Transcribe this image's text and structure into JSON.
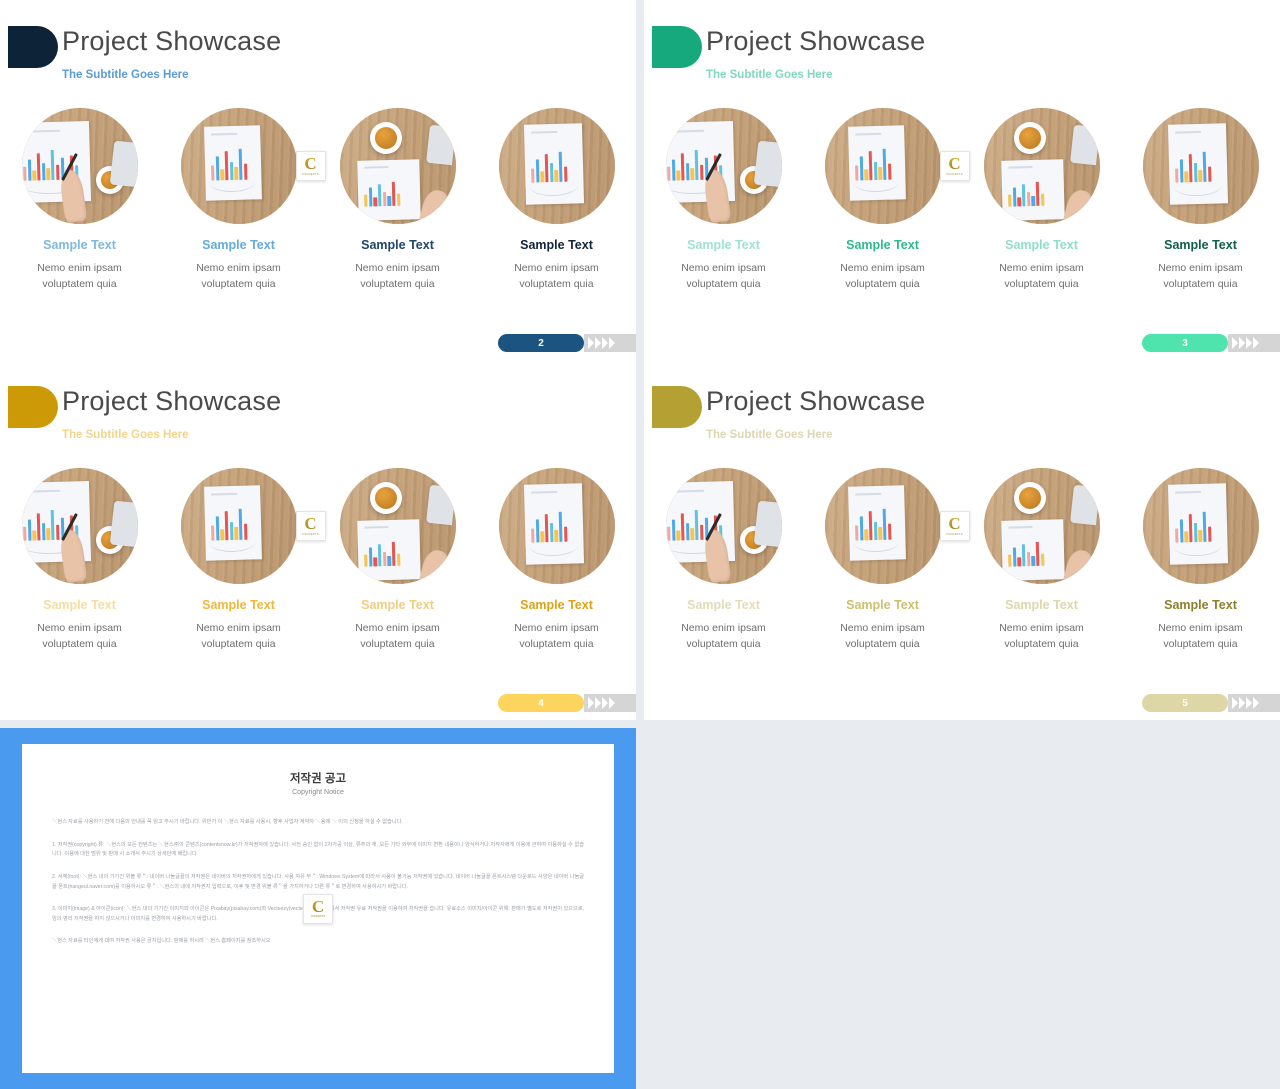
{
  "deck": {
    "slides": [
      {
        "id": "slide-2",
        "title": "Project Showcase",
        "subtitle": "The Subtitle Goes Here",
        "accent": "#0d2337",
        "subtitle_color": "#5b9bd5",
        "pill_color": "#1b5480",
        "page_number": "2",
        "label_colors": [
          "#7fb8e0",
          "#63abdd",
          "#20466a",
          "#13243a"
        ],
        "items": [
          {
            "label": "Sample Text",
            "desc_line1": "Nemo enim ipsam",
            "desc_line2": "voluptatem quia"
          },
          {
            "label": "Sample Text",
            "desc_line1": "Nemo enim ipsam",
            "desc_line2": "voluptatem quia"
          },
          {
            "label": "Sample Text",
            "desc_line1": "Nemo enim ipsam",
            "desc_line2": "voluptatem quia"
          },
          {
            "label": "Sample Text",
            "desc_line1": "Nemo enim ipsam",
            "desc_line2": "voluptatem quia"
          }
        ]
      },
      {
        "id": "slide-3",
        "title": "Project Showcase",
        "subtitle": "The Subtitle Goes Here",
        "accent": "#17a97e",
        "subtitle_color": "#7fd9bd",
        "pill_color": "#4fe3ad",
        "page_number": "3",
        "label_colors": [
          "#9fe3cc",
          "#2eb98f",
          "#8fdfc5",
          "#0f5f49"
        ],
        "items": [
          {
            "label": "Sample Text",
            "desc_line1": "Nemo enim ipsam",
            "desc_line2": "voluptatem quia"
          },
          {
            "label": "Sample Text",
            "desc_line1": "Nemo enim ipsam",
            "desc_line2": "voluptatem quia"
          },
          {
            "label": "Sample Text",
            "desc_line1": "Nemo enim ipsam",
            "desc_line2": "voluptatem quia"
          },
          {
            "label": "Sample Text",
            "desc_line1": "Nemo enim ipsam",
            "desc_line2": "voluptatem quia"
          }
        ]
      },
      {
        "id": "slide-4",
        "title": "Project Showcase",
        "subtitle": "The Subtitle Goes Here",
        "accent": "#cc9a06",
        "subtitle_color": "#f3d48a",
        "pill_color": "#fcd45e",
        "page_number": "4",
        "label_colors": [
          "#f6dda0",
          "#f0b73b",
          "#f3cd7e",
          "#dda317"
        ],
        "items": [
          {
            "label": "Sample Text",
            "desc_line1": "Nemo enim ipsam",
            "desc_line2": "voluptatem quia"
          },
          {
            "label": "Sample Text",
            "desc_line1": "Nemo enim ipsam",
            "desc_line2": "voluptatem quia"
          },
          {
            "label": "Sample Text",
            "desc_line1": "Nemo enim ipsam",
            "desc_line2": "voluptatem quia"
          },
          {
            "label": "Sample Text",
            "desc_line1": "Nemo enim ipsam",
            "desc_line2": "voluptatem quia"
          }
        ]
      },
      {
        "id": "slide-5",
        "title": "Project Showcase",
        "subtitle": "The Subtitle Goes Here",
        "accent": "#b5a033",
        "subtitle_color": "#ded6b0",
        "pill_color": "#ddd6a6",
        "page_number": "5",
        "label_colors": [
          "#e3dcba",
          "#cdbf6e",
          "#ded7ab",
          "#8e7f2c"
        ],
        "items": [
          {
            "label": "Sample Text",
            "desc_line1": "Nemo enim ipsam",
            "desc_line2": "voluptatem quia"
          },
          {
            "label": "Sample Text",
            "desc_line1": "Nemo enim ipsam",
            "desc_line2": "voluptatem quia"
          },
          {
            "label": "Sample Text",
            "desc_line1": "Nemo enim ipsam",
            "desc_line2": "voluptatem quia"
          },
          {
            "label": "Sample Text",
            "desc_line1": "Nemo enim ipsam",
            "desc_line2": "voluptatem quia"
          }
        ]
      }
    ]
  },
  "logo": {
    "letter": "C",
    "wordmark": "CONCEPTS"
  },
  "copyright_slide": {
    "border_color": "#4a9bf0",
    "title_ko": "저작권 공고",
    "title_en": "Copyright Notice",
    "paragraphs": [
      "＼현스 자료를 사용하기 전에 다음의 안내를 꼭 읽고 주시기 바랍니다. 위반가 이 ＼현스 자료를 사용시, 향후 사업자 계약자 ＼용에 ＼ 이의 신청을 하실 수 없습니다.",
      "1. 저작권(copyright) 류: ＼현스의 모든 컨텐츠는 ＼현스㈜의 콘텐츠(contentsnow.kr)가 저작권자에 있습니다. 사전 승인 없이 2차가공 이상, 류주의 재, 모든 기타 외부에 이미지 변환 내용이나 양식하거나 저작자에게 이용에 관하여 이용하실 수 없습니다. 이용에 대한 범위 및 판매 시 소개서 주시기 상세안에 배립니다.",
      "2. 서체(font): ＼현스 내의 기기간 위블 류＂: 네이버 나눔글꼴의 저작권은 네이버의 저작권자에게 있습니다. 사용 자유 무＂: Windows System에 따라서 사용이 불가능 저작권에 있습니다. 네이버 나눔글꼴 폰트시스템 다운로드 사양은 네이버 나눔글꼴 폰트(hangeul.naver.com)를 이용하시오 류＂: ＼현스의 내에 저작권지 입력으로, 이후 및 변경 위블 류＂을 가지하거나 다른 류＂로 변경하여 사용하시기 바랍니다.",
      "3. 이미지(image) & 아이콘(icon): ＼현스 내의 기기간 이미지와 아이콘은 Pixabay(pixabay.com)와 Vecteezy(vecteezy.com) 등에서 저작권 유료 저작권을 이용하여 저작권을 습니다. 유료소스 이미지/아이콘 위해: 판매가 별도로 저작권이 있으므로, 임의 영리 저작권을 하지 않으시거나 이미지를 변경하여 사용하시기 바랍니다.",
      "＼현스 자료를 타인에게 대여 저작권 사용은 금지입니다. 판매를 하시려 ＼현스 홈페이지를 참조하시오"
    ]
  }
}
